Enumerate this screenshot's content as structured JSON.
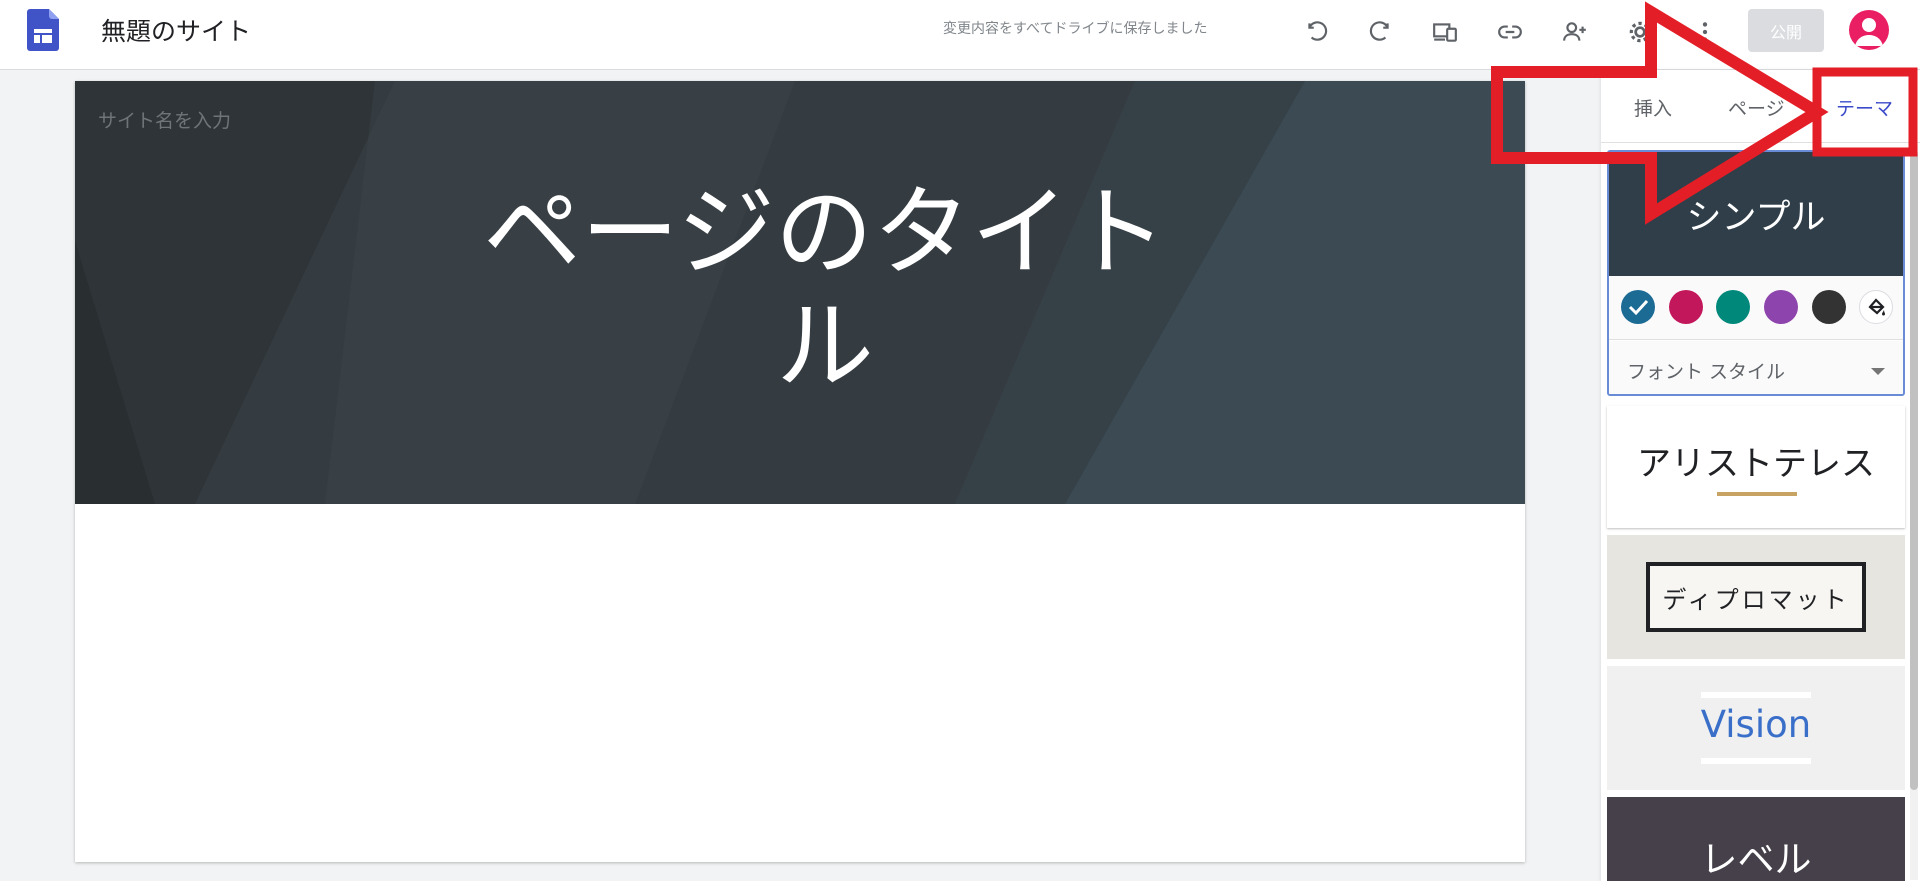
{
  "header": {
    "site_title": "無題のサイト",
    "save_status": "変更内容をすべてドライブに保存しました",
    "publish_label": "公開"
  },
  "canvas": {
    "site_name_placeholder": "サイト名を入力",
    "page_title_line1": "ページのタイト",
    "page_title_line2": "ル"
  },
  "panel": {
    "tabs": [
      {
        "label": "挿入"
      },
      {
        "label": "ページ"
      },
      {
        "label": "テーマ"
      }
    ],
    "active_tab": "テーマ",
    "themes": {
      "simple": "シンプル",
      "aristotle": "アリストテレス",
      "diplomat": "ディプロマット",
      "vision": "Vision",
      "level": "レベル"
    },
    "swatch_colors": [
      "#1c6b94",
      "#c2185b",
      "#00897b",
      "#8e44ad",
      "#333333"
    ],
    "font_style_label": "フォント スタイル"
  },
  "colors": {
    "accent": "#3c4bc9",
    "annotation": "#e41e26",
    "hero_bg": "#33393e"
  }
}
